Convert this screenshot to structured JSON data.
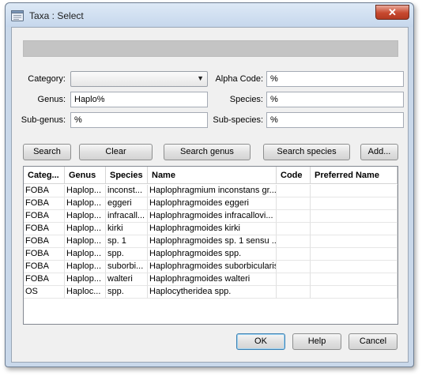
{
  "window": {
    "title": "Taxa : Select",
    "close_glyph": "✕"
  },
  "progress": {
    "value": 0
  },
  "form": {
    "category_label": "Category:",
    "category_value": "",
    "alpha_code_label": "Alpha Code:",
    "alpha_code_value": "%",
    "genus_label": "Genus:",
    "genus_value": "Haplo%",
    "species_label": "Species:",
    "species_value": "%",
    "subgenus_label": "Sub-genus:",
    "subgenus_value": "%",
    "subspecies_label": "Sub-species:",
    "subspecies_value": "%"
  },
  "actions": {
    "search": "Search",
    "clear": "Clear",
    "search_genus": "Search genus",
    "search_species": "Search species",
    "add": "Add..."
  },
  "table": {
    "columns": [
      "Categ...",
      "Genus",
      "Species",
      "Name",
      "Code",
      "Preferred Name"
    ],
    "rows": [
      [
        "FOBA",
        "Haplop...",
        "inconst...",
        "Haplophragmium inconstans gr...",
        "",
        ""
      ],
      [
        "FOBA",
        "Haplop...",
        "eggeri",
        "Haplophragmoides eggeri",
        "",
        ""
      ],
      [
        "FOBA",
        "Haplop...",
        "infracall...",
        "Haplophragmoides infracallovi...",
        "",
        ""
      ],
      [
        "FOBA",
        "Haplop...",
        "kirki",
        "Haplophragmoides kirki",
        "",
        ""
      ],
      [
        "FOBA",
        "Haplop...",
        "sp. 1",
        "Haplophragmoides sp. 1 sensu ...",
        "",
        ""
      ],
      [
        "FOBA",
        "Haplop...",
        "spp.",
        "Haplophragmoides spp.",
        "",
        ""
      ],
      [
        "FOBA",
        "Haplop...",
        "suborbi...",
        "Haplophragmoides suborbicularis",
        "",
        ""
      ],
      [
        "FOBA",
        "Haplop...",
        "walteri",
        "Haplophragmoides walteri",
        "",
        ""
      ],
      [
        "OS",
        "Haploc...",
        "spp.",
        "Haplocytheridea spp.",
        "",
        ""
      ]
    ]
  },
  "footer": {
    "ok": "OK",
    "help": "Help",
    "cancel": "Cancel"
  },
  "icons": {
    "app": "app-icon",
    "close": "close-icon",
    "dropdown": "chevron-down-icon"
  },
  "colors": {
    "title_bar": "#c6d7ec",
    "close_button": "#c7492f",
    "progress_track": "#c4c4c4",
    "default_button_border": "#3c7fb1"
  }
}
